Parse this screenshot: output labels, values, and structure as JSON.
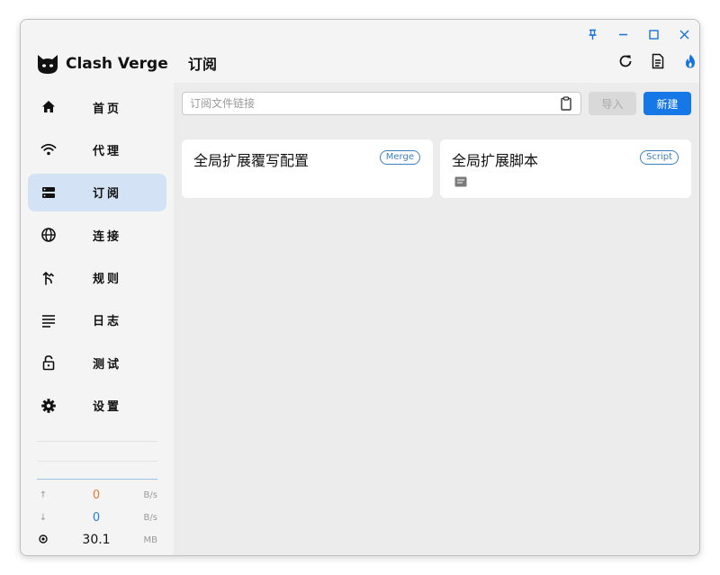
{
  "app": {
    "name": "Clash Verge"
  },
  "sidebar": {
    "items": [
      {
        "label": "首页",
        "icon": "home-icon",
        "active": false
      },
      {
        "label": "代理",
        "icon": "wifi-icon",
        "active": false
      },
      {
        "label": "订阅",
        "icon": "subscription-icon",
        "active": true
      },
      {
        "label": "连接",
        "icon": "globe-icon",
        "active": false
      },
      {
        "label": "规则",
        "icon": "fork-icon",
        "active": false
      },
      {
        "label": "日志",
        "icon": "list-icon",
        "active": false
      },
      {
        "label": "测试",
        "icon": "lock-icon",
        "active": false
      },
      {
        "label": "设置",
        "icon": "gear-icon",
        "active": false
      }
    ]
  },
  "traffic": {
    "upload": {
      "value": "0",
      "unit": "B/s",
      "color": "#e07b3a"
    },
    "download": {
      "value": "0",
      "unit": "B/s",
      "color": "#2a7dd6"
    },
    "memory": {
      "value": "30.1",
      "unit": "MB"
    }
  },
  "header": {
    "title": "订阅"
  },
  "toolbar": {
    "url_placeholder": "订阅文件链接",
    "import_label": "导入",
    "new_label": "新建"
  },
  "cards": [
    {
      "title": "全局扩展覆写配置",
      "badge": "Merge"
    },
    {
      "title": "全局扩展脚本",
      "badge": "Script"
    }
  ],
  "colors": {
    "accent": "#1677e6",
    "active_nav": "#d3e2f4",
    "badge": "#3d7fbf"
  }
}
